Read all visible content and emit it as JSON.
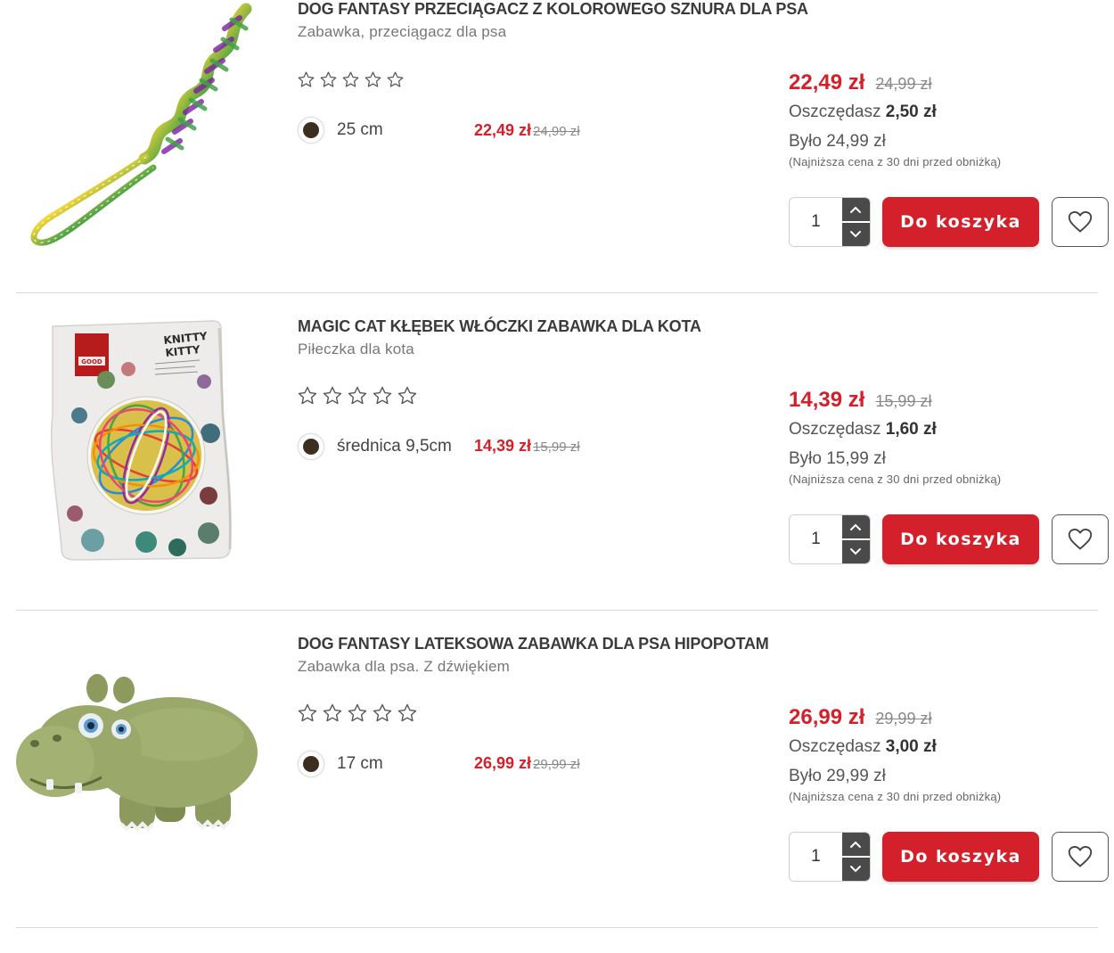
{
  "products": [
    {
      "title": "DOG FANTASY PRZECIĄGACZ Z KOLOROWEGO SZNURA DLA PSA",
      "subtitle": "Zabawka, przeciągacz dla psa",
      "rating": 0,
      "variant": {
        "label": "25 cm",
        "price": "22,49 zł",
        "old_price": "24,99 zł"
      },
      "price": "22,49 zł",
      "old_price": "24,99 zł",
      "saving_label": "Oszczędasz",
      "saving_value": "2,50 zł",
      "was_text": "Było 24,99 zł",
      "lowest_note": "(Najniższa cena z 30 dni przed obniżką)",
      "quantity": "1",
      "cart_label": "Do koszyka",
      "image": "rope-toy"
    },
    {
      "title": "MAGIC CAT KŁĘBEK WŁÓCZKI ZABAWKA DLA KOTA",
      "subtitle": "Piłeczka dla kota",
      "rating": 0,
      "variant": {
        "label": "średnica 9,5cm",
        "price": "14,39 zł",
        "old_price": "15,99 zł"
      },
      "price": "14,39 zł",
      "old_price": "15,99 zł",
      "saving_label": "Oszczędasz",
      "saving_value": "1,60 zł",
      "was_text": "Było 15,99 zł",
      "lowest_note": "(Najniższa cena z 30 dni przed obniżką)",
      "quantity": "1",
      "cart_label": "Do koszyka",
      "image": "yarn-ball-package",
      "image_text": {
        "brand": "KNITTY KITTY",
        "logo": "GOOD"
      }
    },
    {
      "title": "DOG FANTASY LATEKSOWA ZABAWKA DLA PSA HIPOPOTAM",
      "subtitle": "Zabawka dla psa. Z dźwiękiem",
      "rating": 0,
      "variant": {
        "label": "17 cm",
        "price": "26,99 zł",
        "old_price": "29,99 zł"
      },
      "price": "26,99 zł",
      "old_price": "29,99 zł",
      "saving_label": "Oszczędasz",
      "saving_value": "3,00 zł",
      "was_text": "Było 29,99 zł",
      "lowest_note": "(Najniższa cena z 30 dni przed obniżką)",
      "quantity": "1",
      "cart_label": "Do koszyka",
      "image": "hippo-toy"
    }
  ],
  "colors": {
    "accent": "#d4202a",
    "variant_dot": "#3d2e22",
    "divider": "#d9d9d9"
  },
  "icons": {
    "star": "star-outline-icon",
    "heart": "heart-outline-icon",
    "up": "chevron-up-icon",
    "down": "chevron-down-icon"
  }
}
